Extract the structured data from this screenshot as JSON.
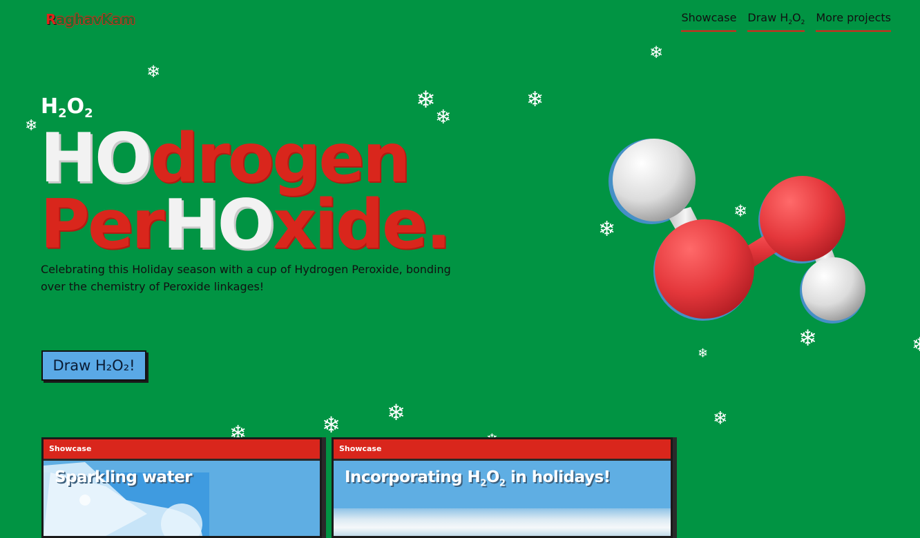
{
  "header": {
    "logo_first": "R",
    "logo_rest": "aghavKam",
    "nav": [
      {
        "label": "Showcase"
      },
      {
        "label_main": "Draw H",
        "sub1": "2",
        "mid": "O",
        "sub2": "2"
      },
      {
        "label": "More projects"
      }
    ]
  },
  "hero": {
    "formula": {
      "h": "H",
      "sub1": "2",
      "o": "O",
      "sub2": "2"
    },
    "headline_line1": [
      {
        "text": "HO",
        "color": "white"
      },
      {
        "text": "drogen",
        "color": "red"
      }
    ],
    "headline_line2": [
      {
        "text": "Per",
        "color": "red"
      },
      {
        "text": "HO",
        "color": "white"
      },
      {
        "text": "xide.",
        "color": "red"
      }
    ],
    "tagline": "Celebrating this Holiday season with a cup of Hydrogen Peroxide, bonding over the chemistry of Peroxide linkages!",
    "cta_label": "Draw H₂O₂!"
  },
  "cards": [
    {
      "tag": "Showcase",
      "title": "Sparkling water"
    },
    {
      "tag": "Showcase",
      "title_main": "Incorporating H",
      "sub1": "2",
      "mid": "O",
      "sub2": "2",
      "title_end": " in holidays!"
    }
  ],
  "colors": {
    "background": "#019443",
    "accent_red": "#d9261c",
    "button_blue": "#5aa9e6",
    "white": "#f2f2f2"
  },
  "icons": [
    "snowflake-icon",
    "molecule-illustration",
    "water-bottle-image",
    "beach-image"
  ]
}
